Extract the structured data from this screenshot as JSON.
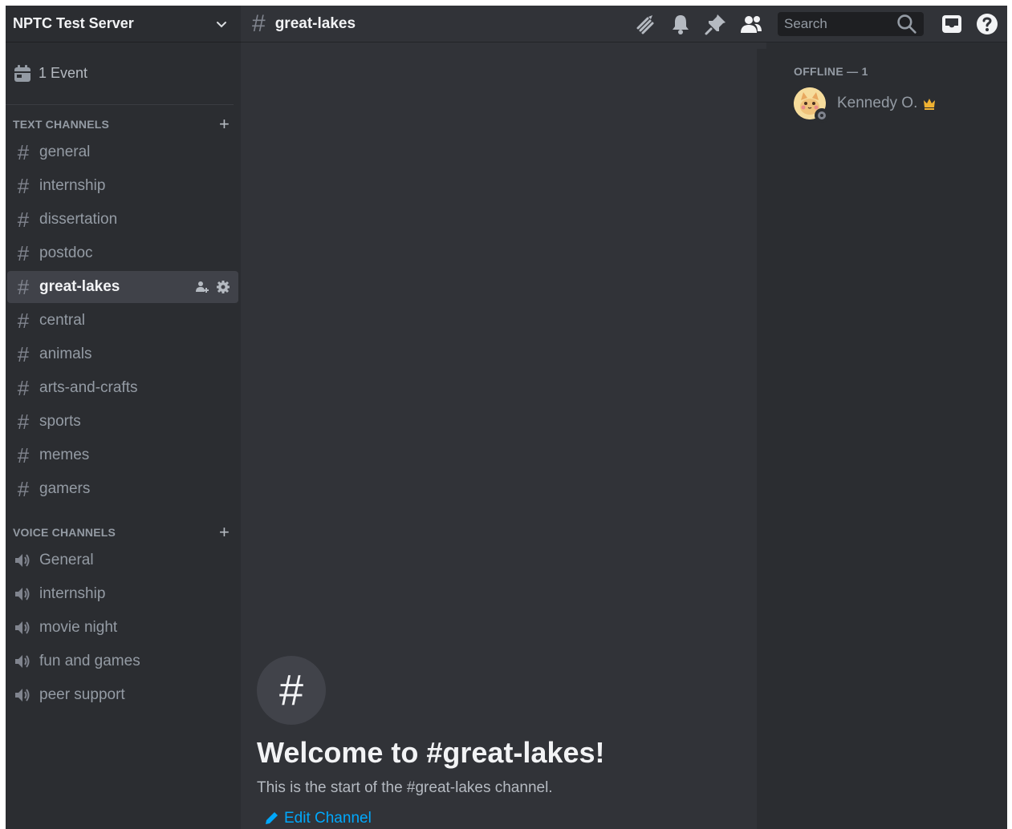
{
  "server": {
    "name": "NPTC Test Server"
  },
  "event": {
    "label": "1 Event"
  },
  "text_category": {
    "label": "TEXT CHANNELS"
  },
  "text_channels": [
    {
      "label": "general"
    },
    {
      "label": "internship"
    },
    {
      "label": "dissertation"
    },
    {
      "label": "postdoc"
    },
    {
      "label": "great-lakes",
      "active": true
    },
    {
      "label": "central"
    },
    {
      "label": "animals"
    },
    {
      "label": "arts-and-crafts"
    },
    {
      "label": "sports"
    },
    {
      "label": "memes"
    },
    {
      "label": "gamers"
    }
  ],
  "voice_category": {
    "label": "VOICE CHANNELS"
  },
  "voice_channels": [
    {
      "label": "General"
    },
    {
      "label": "internship"
    },
    {
      "label": "movie night"
    },
    {
      "label": "fun and games"
    },
    {
      "label": "peer support"
    }
  ],
  "topbar": {
    "channel_name": "great-lakes",
    "search_placeholder": "Search",
    "icons": [
      "threads-icon",
      "bell-icon",
      "pin-icon",
      "members-icon",
      "inbox-icon",
      "help-icon"
    ]
  },
  "welcome": {
    "title": "Welcome to #great-lakes!",
    "description": "This is the start of the #great-lakes channel.",
    "edit_label": "Edit Channel"
  },
  "members": {
    "section_label": "OFFLINE — 1",
    "list": [
      {
        "name": "Kennedy O.",
        "owner": true,
        "status": "offline"
      }
    ]
  },
  "colors": {
    "sidebar_bg": "#2b2d31",
    "main_bg": "#313338",
    "active_channel_bg": "#404249",
    "link": "#00a8fc",
    "crown": "#f0b232"
  }
}
